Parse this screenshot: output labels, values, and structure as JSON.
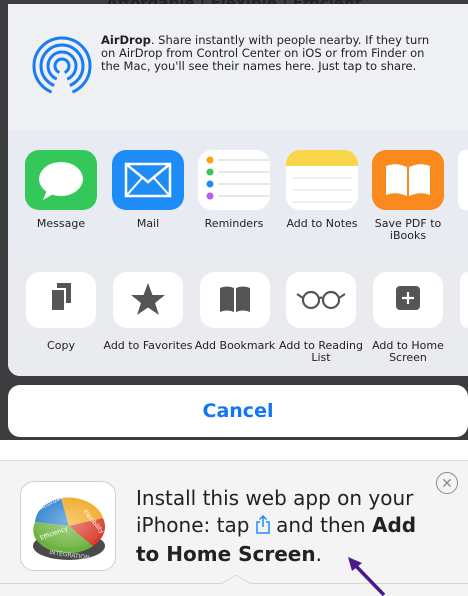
{
  "background_page": {
    "title_fragment": "Affordable | Flexible | Efficient"
  },
  "airdrop": {
    "heading": "AirDrop",
    "description": ". Share instantly with people nearby. If they turn on AirDrop from Control Center on iOS or from Finder on the Mac, you'll see their names here. Just tap to share."
  },
  "apps": [
    {
      "label": "Message",
      "icon": "messages-icon"
    },
    {
      "label": "Mail",
      "icon": "mail-icon"
    },
    {
      "label": "Reminders",
      "icon": "reminders-icon"
    },
    {
      "label": "Add to Notes",
      "icon": "notes-icon"
    },
    {
      "label": "Save PDF to iBooks",
      "icon": "ibooks-icon"
    }
  ],
  "actions": [
    {
      "label": "Copy",
      "icon": "copy-icon"
    },
    {
      "label": "Add to Favorites",
      "icon": "star-icon"
    },
    {
      "label": "Add Bookmark",
      "icon": "bookmark-book-icon"
    },
    {
      "label": "Add to Reading List",
      "icon": "glasses-icon"
    },
    {
      "label": "Add to Home Screen",
      "icon": "plus-square-icon"
    }
  ],
  "cancel_label": "Cancel",
  "install_banner": {
    "text_part1": "Install this web app on your iPhone: tap",
    "text_part2": "and then",
    "text_bold": "Add to Home Screen",
    "text_end": ".",
    "icon_labels": [
      "Affordability",
      "Flexibility",
      "Efficiency",
      "INTEGRATION"
    ],
    "close_icon": "close-circle-icon"
  },
  "colors": {
    "accent": "#1476f0",
    "messages_green": "#34c759",
    "mail_blue": "#1e8cf7",
    "notes_yellow": "#f9d648",
    "ibooks_orange": "#fb8a1e",
    "annotation_arrow": "#4a1a8c"
  }
}
